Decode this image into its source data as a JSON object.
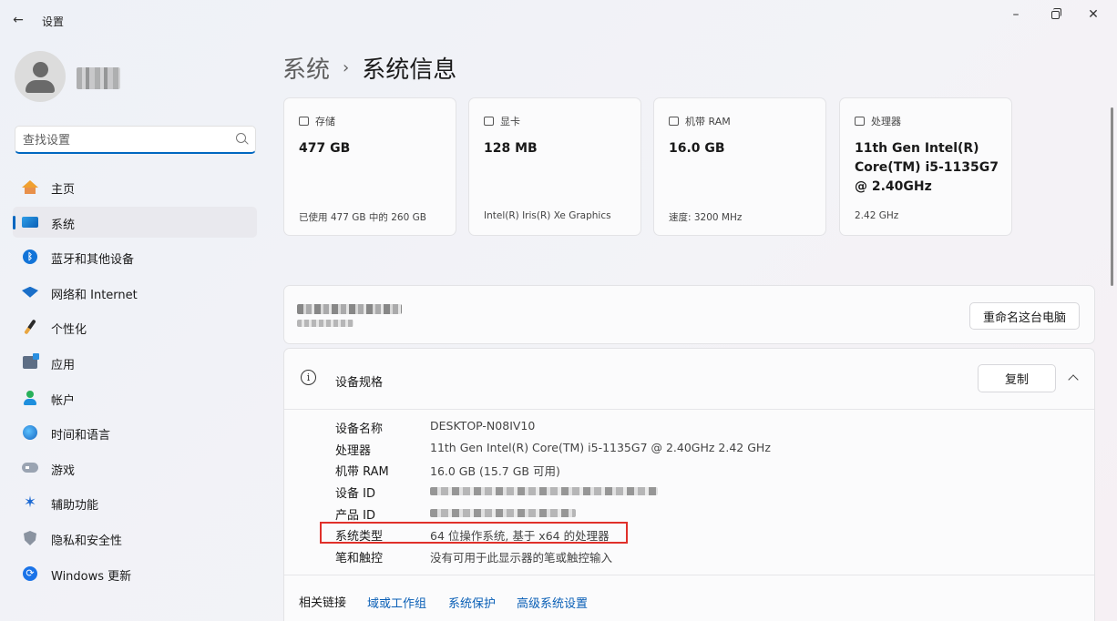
{
  "window": {
    "title": "设置",
    "back_glyph": "←",
    "minimize_glyph": "–",
    "close_glyph": "✕"
  },
  "search": {
    "placeholder": "查找设置"
  },
  "sidebar": {
    "items": [
      {
        "label": "主页",
        "icon": "home-icon"
      },
      {
        "label": "系统",
        "icon": "system-icon",
        "active": true
      },
      {
        "label": "蓝牙和其他设备",
        "icon": "bluetooth-icon"
      },
      {
        "label": "网络和 Internet",
        "icon": "wifi-icon"
      },
      {
        "label": "个性化",
        "icon": "brush-icon"
      },
      {
        "label": "应用",
        "icon": "apps-icon"
      },
      {
        "label": "帐户",
        "icon": "account-icon"
      },
      {
        "label": "时间和语言",
        "icon": "globe-icon"
      },
      {
        "label": "游戏",
        "icon": "gamepad-icon"
      },
      {
        "label": "辅助功能",
        "icon": "accessibility-icon"
      },
      {
        "label": "隐私和安全性",
        "icon": "shield-icon"
      },
      {
        "label": "Windows 更新",
        "icon": "update-icon"
      }
    ]
  },
  "breadcrumb": {
    "parent": "系统",
    "separator": "›",
    "current": "系统信息"
  },
  "cards": [
    {
      "title": "存储",
      "value": "477 GB",
      "sub": "已使用 477 GB 中的 260 GB",
      "icon": "storage-icon"
    },
    {
      "title": "显卡",
      "value": "128 MB",
      "sub": "Intel(R) Iris(R) Xe Graphics",
      "icon": "gpu-icon"
    },
    {
      "title": "机带 RAM",
      "value": "16.0 GB",
      "sub": "速度: 3200 MHz",
      "icon": "ram-icon"
    },
    {
      "title": "处理器",
      "value": "11th Gen Intel(R) Core(TM) i5-1135G7 @ 2.40GHz",
      "sub": "2.42 GHz",
      "icon": "cpu-icon"
    }
  ],
  "pc": {
    "rename_label": "重命名这台电脑"
  },
  "specs": {
    "title": "设备规格",
    "copy_label": "复制",
    "rows": [
      {
        "key": "设备名称",
        "value": "DESKTOP-N08IV10"
      },
      {
        "key": "处理器",
        "value": "11th Gen Intel(R) Core(TM) i5-1135G7 @ 2.40GHz   2.42 GHz"
      },
      {
        "key": "机带 RAM",
        "value": "16.0 GB (15.7 GB 可用)"
      },
      {
        "key": "设备 ID",
        "value": ""
      },
      {
        "key": "产品 ID",
        "value": ""
      },
      {
        "key": "系统类型",
        "value": "64 位操作系统, 基于 x64 的处理器"
      },
      {
        "key": "笔和触控",
        "value": "没有可用于此显示器的笔或触控输入"
      }
    ]
  },
  "related": {
    "label": "相关链接",
    "links": [
      "域或工作组",
      "系统保护",
      "高级系统设置"
    ]
  },
  "colors": {
    "accent": "#0067c0",
    "highlight": "#e0302a"
  }
}
